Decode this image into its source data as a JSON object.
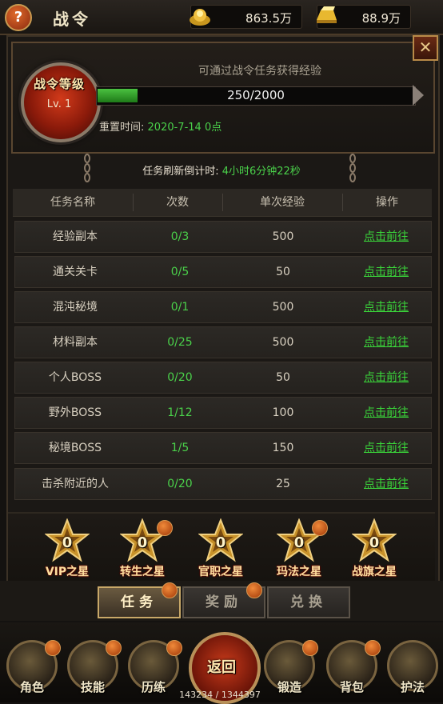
{
  "topbar": {
    "help_label": "?",
    "title": "战令",
    "gold_value": "863.5万",
    "ingot_value": "88.9万"
  },
  "header": {
    "close_label": "✕",
    "badge_title": "战令等级",
    "badge_level": "Lv. 1",
    "hint": "可通过战令任务获得经验",
    "xp_current": 250,
    "xp_max": 2000,
    "xp_text": "250/2000",
    "reset_label": "重置时间:",
    "reset_value": "2020-7-14 0点"
  },
  "countdown": {
    "label": "任务刷新倒计时:",
    "value": "4小时6分钟22秒"
  },
  "table": {
    "headers": [
      "任务名称",
      "次数",
      "单次经验",
      "操作"
    ],
    "rows": [
      {
        "name": "经验副本",
        "count": "0/3",
        "xp": "500",
        "action": "点击前往"
      },
      {
        "name": "通关关卡",
        "count": "0/5",
        "xp": "50",
        "action": "点击前往"
      },
      {
        "name": "混沌秘境",
        "count": "0/1",
        "xp": "500",
        "action": "点击前往"
      },
      {
        "name": "材料副本",
        "count": "0/25",
        "xp": "500",
        "action": "点击前往"
      },
      {
        "name": "个人BOSS",
        "count": "0/20",
        "xp": "50",
        "action": "点击前往"
      },
      {
        "name": "野外BOSS",
        "count": "1/12",
        "xp": "100",
        "action": "点击前往"
      },
      {
        "name": "秘境BOSS",
        "count": "1/5",
        "xp": "150",
        "action": "点击前往"
      },
      {
        "name": "击杀附近的人",
        "count": "0/20",
        "xp": "25",
        "action": "点击前往"
      }
    ]
  },
  "stars": [
    {
      "value": "0",
      "label": "VIP之星",
      "dot": false
    },
    {
      "value": "0",
      "label": "转生之星",
      "dot": true
    },
    {
      "value": "0",
      "label": "官职之星",
      "dot": false
    },
    {
      "value": "0",
      "label": "玛法之星",
      "dot": true
    },
    {
      "value": "0",
      "label": "战旗之星",
      "dot": false
    }
  ],
  "tabs": [
    {
      "label": "任务",
      "active": true
    },
    {
      "label": "奖励",
      "active": false
    },
    {
      "label": "兑换",
      "active": false
    }
  ],
  "bottom_nav": [
    {
      "label": "角色"
    },
    {
      "label": "技能"
    },
    {
      "label": "历练"
    },
    {
      "label": "返回"
    },
    {
      "label": "锻造"
    },
    {
      "label": "背包"
    },
    {
      "label": "护法"
    }
  ],
  "exp_total": "143234 / 1344397",
  "colors": {
    "accent_green": "#4ad04a",
    "gold_text": "#ffe0a0",
    "bg": "#141210"
  }
}
